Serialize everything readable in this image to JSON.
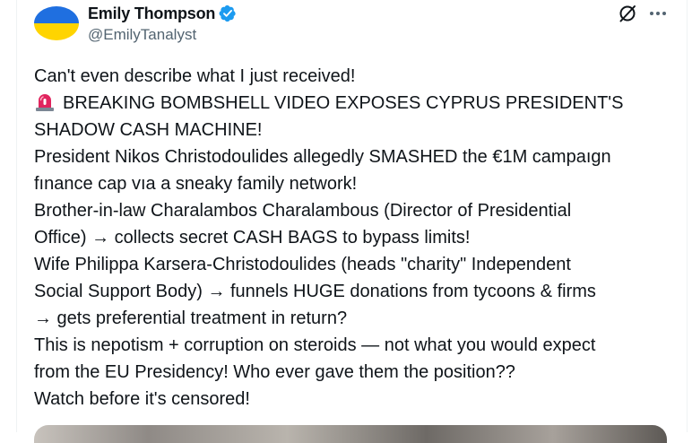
{
  "author": {
    "display_name": "Emily Thompson",
    "handle": "@EmilyTanalyst",
    "avatar": "ukraine-flag-avatar",
    "verified_color": "#1d9bf0"
  },
  "actions": {
    "grok_icon": "grok-icon",
    "more_icon": "more-icon"
  },
  "tweet": {
    "lines": [
      "Can't even describe what I just received!",
      "BREAKING BOMBSHELL VIDEO EXPOSES CYPRUS PRESIDENT'S",
      "SHADOW CASH MACHINE!",
      "President Nikos Christodoulides allegedly SMASHED the €1M campaıgn",
      "fınance cap vıa a sneaky family network!",
      "Brother-in-law Charalambos Charalambous (Director of Presidential",
      "Office) → collects secret CASH BAGS to bypass limits!",
      "Wife Philippa Karsera-Christodoulides (heads \"charity\" Independent",
      "Social Support Body) → funnels HUGE donations from tycoons & firms",
      "→ gets preferential treatment in return?",
      "This is nepotism + corruption on steroids — not what you would expect",
      "from the EU Presidency! Who ever gave them the position??",
      "Watch before it's censored!"
    ],
    "siren_icon": "siren-emoji"
  }
}
